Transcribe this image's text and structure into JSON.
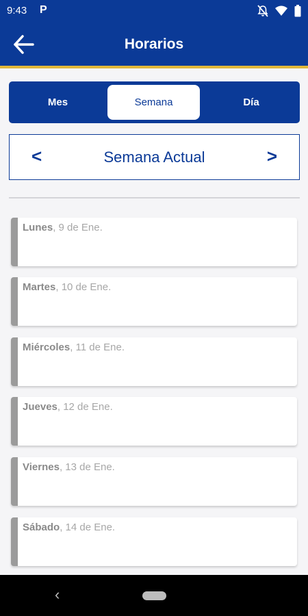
{
  "status_bar": {
    "time": "9:43",
    "app_icon": "P",
    "icons": [
      "notifications-off-icon",
      "wifi-icon",
      "battery-icon"
    ]
  },
  "app_bar": {
    "title": "Horarios",
    "back_icon": "arrow-left-icon",
    "accent_color": "#e0b73a",
    "brand_color": "#0b3a97"
  },
  "view_tabs": {
    "items": [
      {
        "label": "Mes",
        "active": false
      },
      {
        "label": "Semana",
        "active": true
      },
      {
        "label": "Día",
        "active": false
      }
    ]
  },
  "week_nav": {
    "prev": "<",
    "label": "Semana Actual",
    "next": ">"
  },
  "days": [
    {
      "name": "Lunes",
      "date": ", 9 de Ene."
    },
    {
      "name": "Martes",
      "date": ", 10 de Ene."
    },
    {
      "name": "Miércoles",
      "date": ", 11 de Ene."
    },
    {
      "name": "Jueves",
      "date": ", 12 de Ene."
    },
    {
      "name": "Viernes",
      "date": ", 13 de Ene."
    },
    {
      "name": "Sábado",
      "date": ", 14 de Ene."
    }
  ],
  "nav_bar": {
    "back": "‹"
  }
}
